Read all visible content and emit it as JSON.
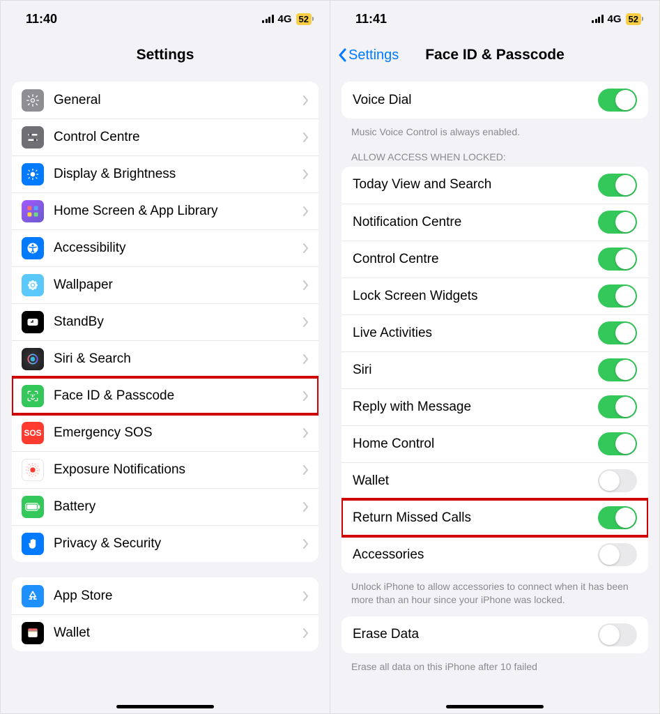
{
  "left": {
    "status": {
      "time": "11:40",
      "network": "4G",
      "battery": "52"
    },
    "title": "Settings",
    "group1": [
      {
        "id": "general",
        "label": "General",
        "icon": "gear",
        "bg": "bg-gray"
      },
      {
        "id": "control-centre",
        "label": "Control Centre",
        "icon": "sliders",
        "bg": "bg-darkgray"
      },
      {
        "id": "display-brightness",
        "label": "Display & Brightness",
        "icon": "sun",
        "bg": "bg-blue"
      },
      {
        "id": "home-screen",
        "label": "Home Screen & App Library",
        "icon": "grid",
        "bg": "bg-purple"
      },
      {
        "id": "accessibility",
        "label": "Accessibility",
        "icon": "accessibility",
        "bg": "bg-blue"
      },
      {
        "id": "wallpaper",
        "label": "Wallpaper",
        "icon": "flower",
        "bg": "bg-teal"
      },
      {
        "id": "standby",
        "label": "StandBy",
        "icon": "clock",
        "bg": "bg-black"
      },
      {
        "id": "siri-search",
        "label": "Siri & Search",
        "icon": "siri",
        "bg": "bg-siri"
      },
      {
        "id": "face-id",
        "label": "Face ID & Passcode",
        "icon": "faceid",
        "bg": "bg-green",
        "highlight": true
      },
      {
        "id": "emergency-sos",
        "label": "Emergency SOS",
        "icon": "sos",
        "bg": "bg-red"
      },
      {
        "id": "exposure",
        "label": "Exposure Notifications",
        "icon": "exposure",
        "bg": "bg-white"
      },
      {
        "id": "battery",
        "label": "Battery",
        "icon": "battery",
        "bg": "bg-green"
      },
      {
        "id": "privacy",
        "label": "Privacy & Security",
        "icon": "hand",
        "bg": "bg-bluepriv"
      }
    ],
    "group2": [
      {
        "id": "app-store",
        "label": "App Store",
        "icon": "appstore",
        "bg": "bg-appstore"
      },
      {
        "id": "wallet",
        "label": "Wallet",
        "icon": "wallet",
        "bg": "bg-black"
      }
    ]
  },
  "right": {
    "status": {
      "time": "11:41",
      "network": "4G",
      "battery": "52"
    },
    "back_label": "Settings",
    "title": "Face ID & Passcode",
    "voice_dial": {
      "label": "Voice Dial",
      "on": true
    },
    "voice_footer": "Music Voice Control is always enabled.",
    "access_header": "ALLOW ACCESS WHEN LOCKED:",
    "access_items": [
      {
        "id": "today-view",
        "label": "Today View and Search",
        "on": true
      },
      {
        "id": "notification-centre",
        "label": "Notification Centre",
        "on": true
      },
      {
        "id": "control-centre",
        "label": "Control Centre",
        "on": true
      },
      {
        "id": "lock-screen-widgets",
        "label": "Lock Screen Widgets",
        "on": true
      },
      {
        "id": "live-activities",
        "label": "Live Activities",
        "on": true
      },
      {
        "id": "siri",
        "label": "Siri",
        "on": true
      },
      {
        "id": "reply-message",
        "label": "Reply with Message",
        "on": true
      },
      {
        "id": "home-control",
        "label": "Home Control",
        "on": true
      },
      {
        "id": "wallet",
        "label": "Wallet",
        "on": false
      },
      {
        "id": "return-missed-calls",
        "label": "Return Missed Calls",
        "on": true,
        "highlight": true
      },
      {
        "id": "accessories",
        "label": "Accessories",
        "on": false
      }
    ],
    "access_footer": "Unlock iPhone to allow accessories to connect when it has been more than an hour since your iPhone was locked.",
    "erase": {
      "label": "Erase Data",
      "on": false
    },
    "erase_footer": "Erase all data on this iPhone after 10 failed"
  }
}
